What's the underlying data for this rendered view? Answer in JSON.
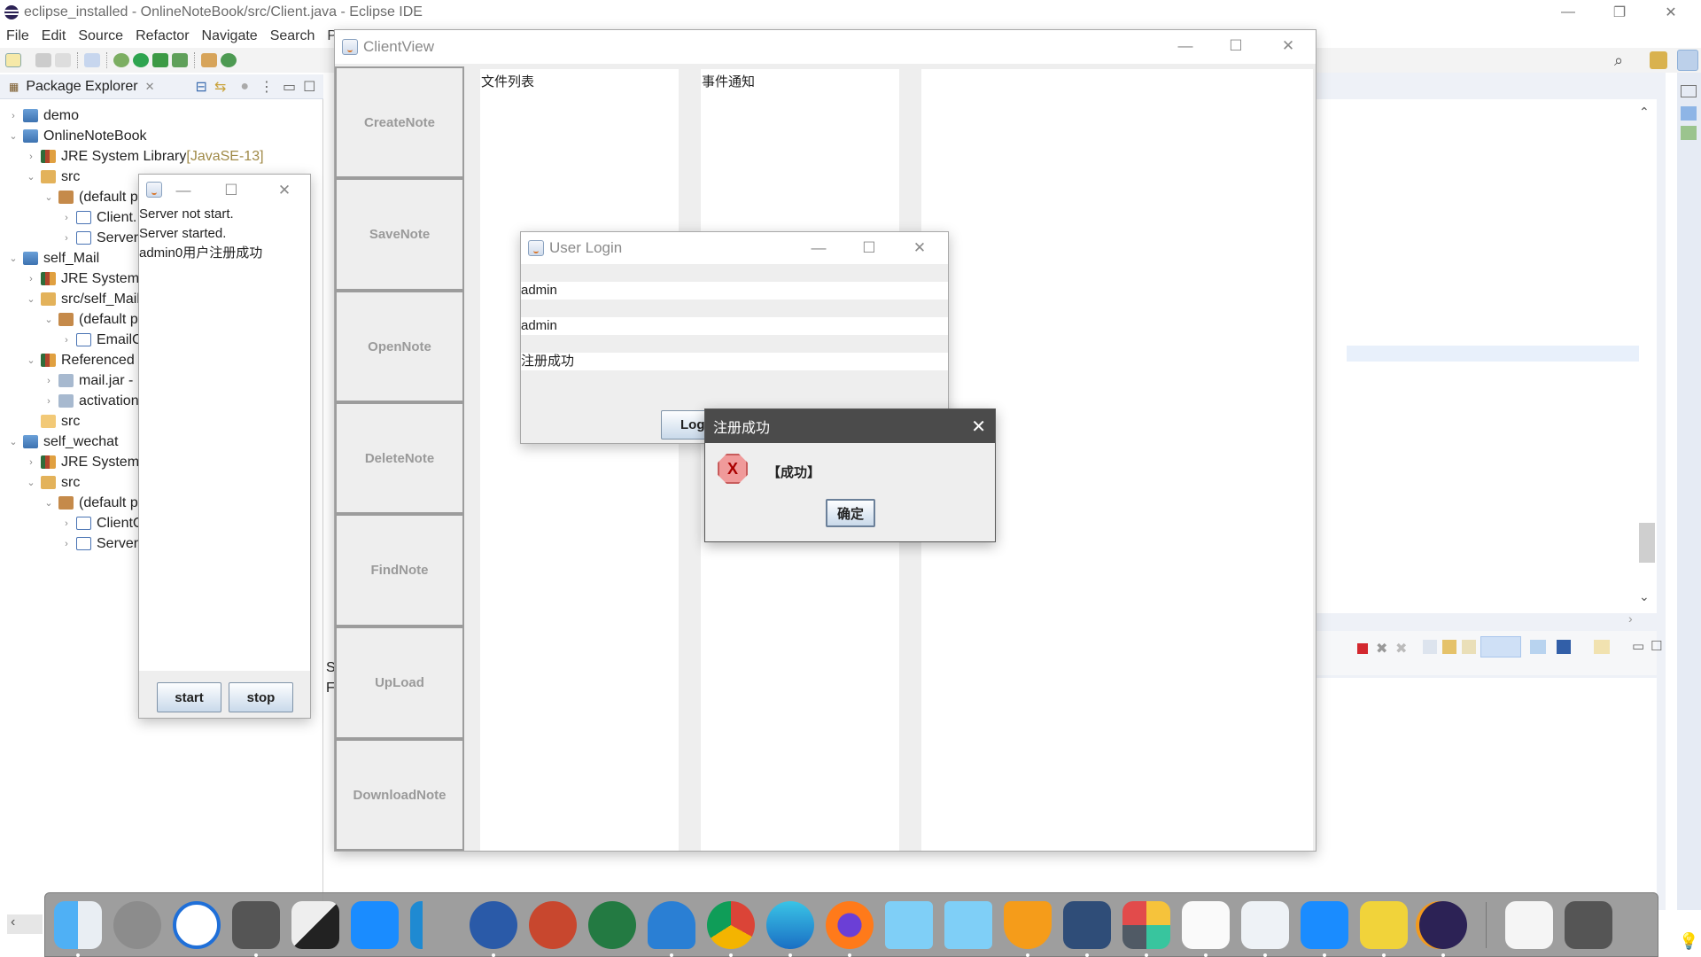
{
  "eclipse": {
    "title": "eclipse_installed - OnlineNoteBook/src/Client.java - Eclipse IDE",
    "menu": [
      "File",
      "Edit",
      "Source",
      "Refactor",
      "Navigate",
      "Search",
      "P"
    ],
    "package_explorer": {
      "tab_label": "Package Explorer",
      "tree": [
        {
          "label": "demo",
          "depth": 0,
          "twisty": ">",
          "icon": "project-icon"
        },
        {
          "label": "OnlineNoteBook",
          "depth": 0,
          "twisty": "v",
          "icon": "project-icon"
        },
        {
          "label": "JRE System Library",
          "decoration": "[JavaSE-13]",
          "depth": 1,
          "twisty": ">",
          "icon": "library-icon"
        },
        {
          "label": "src",
          "depth": 1,
          "twisty": "v",
          "icon": "source-folder-icon"
        },
        {
          "label": "(default p",
          "depth": 2,
          "twisty": "v",
          "icon": "package-icon"
        },
        {
          "label": "Client.",
          "depth": 3,
          "twisty": ">",
          "icon": "java-file-icon"
        },
        {
          "label": "Server",
          "depth": 3,
          "twisty": ">",
          "icon": "java-file-icon"
        },
        {
          "label": "self_Mail",
          "depth": 0,
          "twisty": "v",
          "icon": "project-icon"
        },
        {
          "label": "JRE System I",
          "depth": 1,
          "twisty": ">",
          "icon": "library-icon"
        },
        {
          "label": "src/self_Mail",
          "depth": 1,
          "twisty": "v",
          "icon": "source-folder-icon"
        },
        {
          "label": "(default p",
          "depth": 2,
          "twisty": "v",
          "icon": "package-icon"
        },
        {
          "label": "EmailC",
          "depth": 3,
          "twisty": ">",
          "icon": "java-file-icon"
        },
        {
          "label": "Referenced",
          "depth": 1,
          "twisty": "v",
          "icon": "library-icon"
        },
        {
          "label": "mail.jar - ",
          "depth": 2,
          "twisty": ">",
          "icon": "jar-icon"
        },
        {
          "label": "activation",
          "depth": 2,
          "twisty": ">",
          "icon": "jar-icon"
        },
        {
          "label": "src",
          "depth": 1,
          "twisty": "",
          "icon": "folder-icon"
        },
        {
          "label": "self_wechat",
          "depth": 0,
          "twisty": "v",
          "icon": "project-icon"
        },
        {
          "label": "JRE System I",
          "depth": 1,
          "twisty": ">",
          "icon": "library-icon"
        },
        {
          "label": "src",
          "depth": 1,
          "twisty": "v",
          "icon": "source-folder-icon"
        },
        {
          "label": "(default p",
          "depth": 2,
          "twisty": "v",
          "icon": "package-icon"
        },
        {
          "label": "ClientC",
          "depth": 3,
          "twisty": ">",
          "icon": "java-file-icon"
        },
        {
          "label": "Server",
          "depth": 3,
          "twisty": ">",
          "icon": "java-file-icon"
        }
      ]
    },
    "console_fragment": [
      "S",
      "F"
    ]
  },
  "server_window": {
    "log": [
      "Server not start.",
      "Server started.",
      "admin0用户注册成功"
    ],
    "start_label": "start",
    "stop_label": "stop"
  },
  "client_view": {
    "title": "ClientView",
    "buttons": [
      "CreateNote",
      "SaveNote",
      "OpenNote",
      "DeleteNote",
      "FindNote",
      "UpLoad",
      "DownloadNote"
    ],
    "file_list_header": "文件列表",
    "event_header": "事件通知"
  },
  "user_login": {
    "title": "User Login",
    "username_value": "admin",
    "password_value": "admin",
    "status_value": "注册成功",
    "login_label": "Log"
  },
  "message_dialog": {
    "title": "注册成功",
    "message": "【成功】",
    "ok_label": "确定"
  },
  "dock": {
    "apps": [
      "Finder",
      "Launchpad",
      "IU",
      "System Preferences",
      "Deskflow",
      "DingTalk",
      "Visual Studio Code",
      "Word",
      "PowerPoint",
      "Excel",
      "OneDrive",
      "Chrome",
      "Edge",
      "Firefox",
      "Folder",
      "Folder",
      "Huorong",
      "VirtualBox",
      "Tiles",
      "TextEdit",
      "Java",
      "DingTalk",
      "Help",
      "Eclipse",
      "Screenshot",
      "Trash"
    ]
  }
}
